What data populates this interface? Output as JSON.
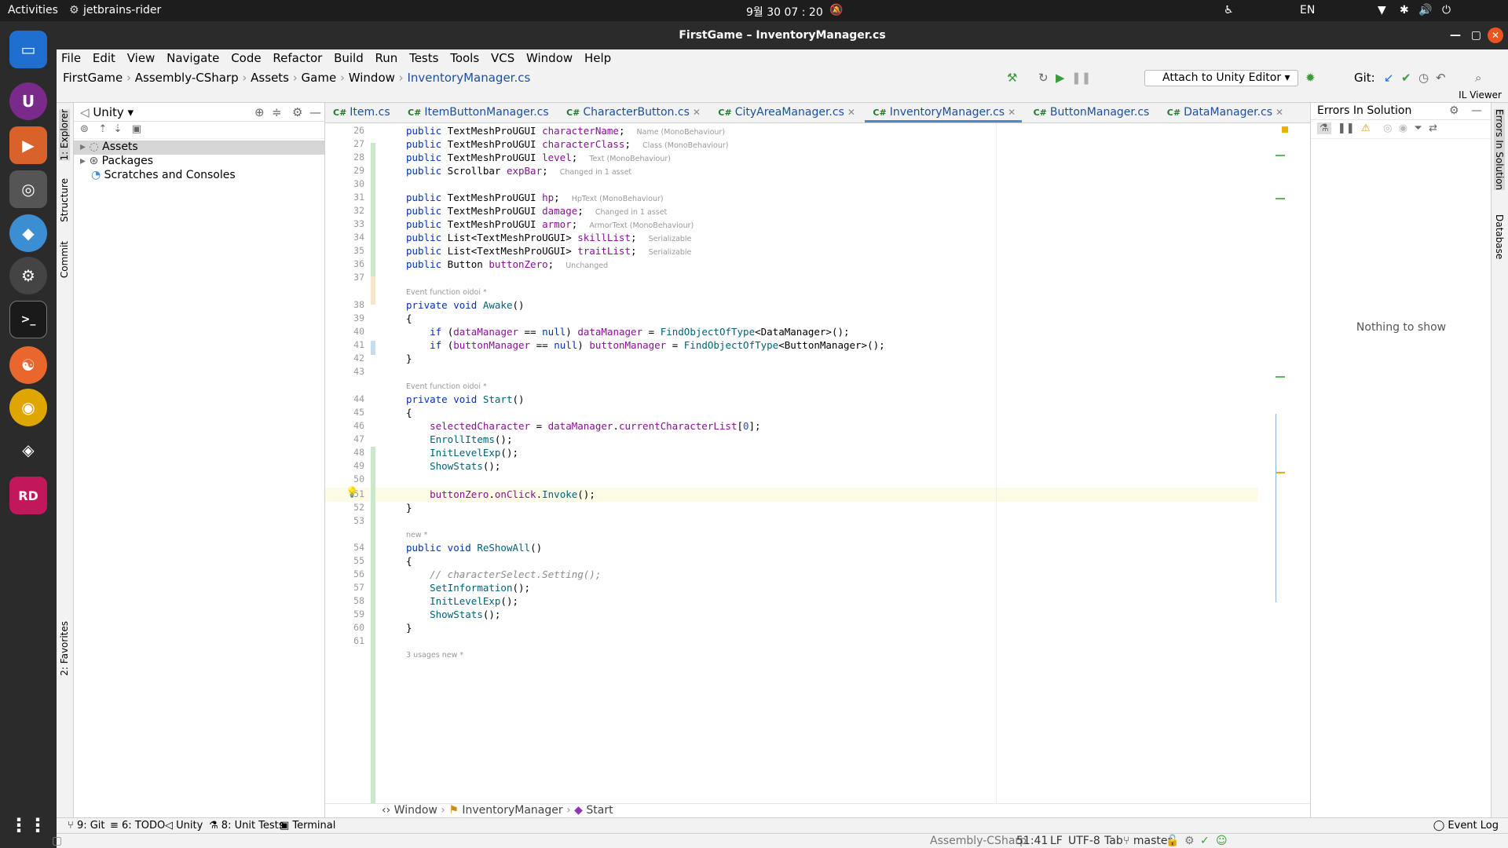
{
  "gnome": {
    "activities": "Activities",
    "app": "jetbrains-rider",
    "clock": "9월 30  07 : 20",
    "lang": "EN"
  },
  "window": {
    "title": "FirstGame – InventoryManager.cs"
  },
  "menu": [
    "File",
    "Edit",
    "View",
    "Navigate",
    "Code",
    "Refactor",
    "Build",
    "Run",
    "Tests",
    "Tools",
    "VCS",
    "Window",
    "Help"
  ],
  "nav": {
    "crumbs": [
      "FirstGame",
      "Assembly-CSharp",
      "Assets",
      "Game",
      "Window",
      "InventoryManager.cs"
    ],
    "attach": "Attach to Unity Editor",
    "git": "Git:",
    "il_viewer": "IL Viewer"
  },
  "project": {
    "title": "Unity",
    "items": [
      "Assets",
      "Packages",
      "Scratches and Consoles"
    ]
  },
  "left_tabs": [
    "1: Explorer",
    "Structure",
    "Commit",
    "2: Favorites"
  ],
  "tabs": [
    {
      "label": "Item.cs"
    },
    {
      "label": "ItemButtonManager.cs"
    },
    {
      "label": "CharacterButton.cs"
    },
    {
      "label": "CityAreaManager.cs"
    },
    {
      "label": "InventoryManager.cs",
      "active": true
    },
    {
      "label": "ButtonManager.cs"
    },
    {
      "label": "DataManager.cs"
    }
  ],
  "tab_prefix": "C#",
  "code": {
    "line_numbers": [
      "26",
      "27",
      "28",
      "29",
      "30",
      "31",
      "32",
      "33",
      "34",
      "35",
      "36",
      "37",
      "38",
      "39",
      "40",
      "41",
      "42",
      "43",
      "44",
      "45",
      "46",
      "47",
      "48",
      "49",
      "50",
      "51",
      "52",
      "53",
      "54",
      "55",
      "56",
      "57",
      "58",
      "59",
      "60",
      "61"
    ],
    "hints": {
      "name": "Name (MonoBehaviour)",
      "class": "Class (MonoBehaviour)",
      "level": "Text (MonoBehaviour)",
      "exp": "Changed in 1 asset",
      "hp": "HpText (MonoBehaviour)",
      "damage": "Changed in 1 asset",
      "armor": "ArmorText (MonoBehaviour)",
      "ser": "Serializable",
      "unch": "Unchanged",
      "event": "Event function",
      "author": "oidoi *",
      "new": "new *",
      "usages": "3 usages"
    }
  },
  "editor_crumb": [
    "Window",
    "InventoryManager",
    "Start"
  ],
  "errors": {
    "title": "Errors In Solution",
    "empty": "Nothing to show"
  },
  "right_tabs": [
    "Errors In Solution",
    "Database"
  ],
  "toolwindows": [
    "9: Git",
    "6: TODO",
    "Unity",
    "8: Unit Tests",
    "Terminal"
  ],
  "event_log": "Event Log",
  "status": {
    "context": "Assembly-CSharp",
    "pos": "51:41",
    "eol": "LF",
    "enc": "UTF-8",
    "indent": "Tab",
    "branch": "master"
  }
}
